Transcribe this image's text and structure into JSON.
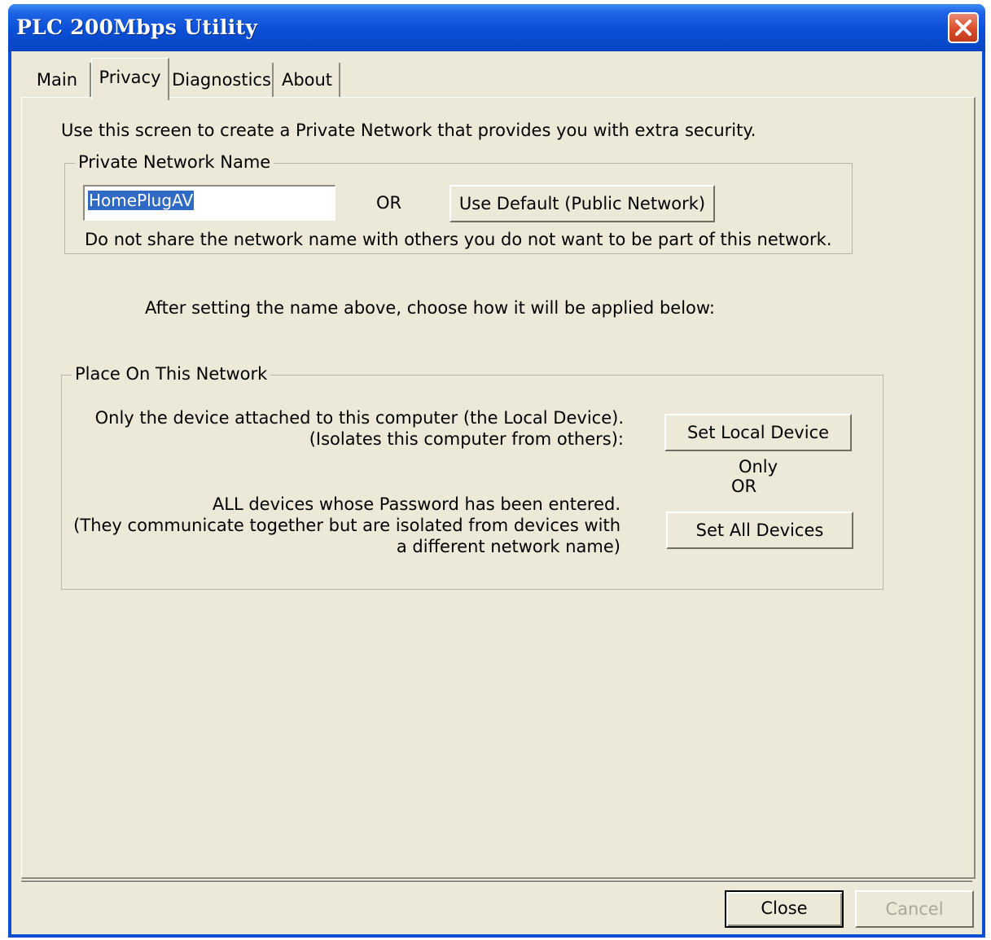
{
  "window": {
    "title": "PLC 200Mbps Utility"
  },
  "tabs": [
    {
      "label": "Main",
      "active": false
    },
    {
      "label": "Privacy",
      "active": true
    },
    {
      "label": "Diagnostics",
      "active": false
    },
    {
      "label": "About",
      "active": false
    }
  ],
  "privacy": {
    "intro": "Use this screen to create a Private Network that provides you with extra security.",
    "private_network": {
      "legend": "Private Network Name",
      "name_value": "HomePlugAV",
      "or_label": "OR",
      "default_button": "Use Default (Public Network)",
      "warning": "Do not share the network name with others you do not want to be part of this network."
    },
    "instruction": "After setting the name above, choose how it will be applied below:",
    "place": {
      "legend": "Place On This Network",
      "local_line1": "Only the device attached to this computer (the Local Device).",
      "local_line2": "(Isolates this computer from others):",
      "local_button": "Set Local Device Only",
      "or_label": "OR",
      "all_line1": "ALL devices whose Password has been entered.",
      "all_line2": "(They communicate together but are isolated from devices with",
      "all_line3": "a different network name)",
      "all_button": "Set All Devices"
    }
  },
  "footer": {
    "close_button": "Close",
    "cancel_button": "Cancel"
  },
  "colors": {
    "title_bar": "#0a4fd6",
    "dialog_face": "#ece9d8",
    "selection": "#316ac5",
    "close_red": "#d84d2c"
  }
}
